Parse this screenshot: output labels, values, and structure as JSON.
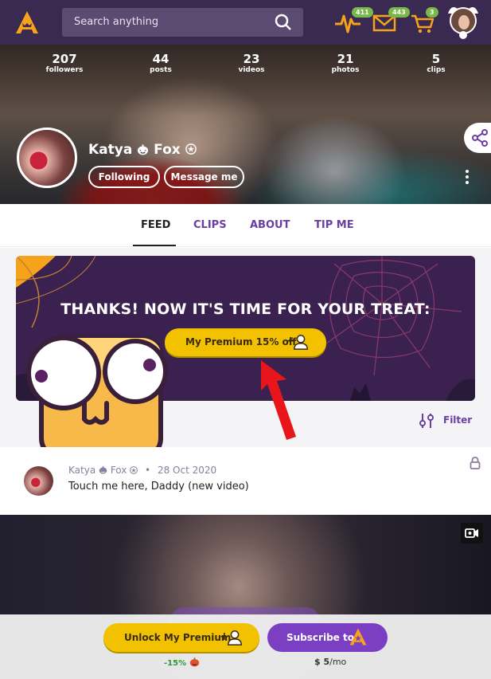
{
  "header": {
    "search_placeholder": "Search anything",
    "badges": {
      "activity": "411",
      "messages": "443",
      "cart": "3"
    }
  },
  "profile": {
    "stats": [
      {
        "value": "207",
        "label": "followers"
      },
      {
        "value": "44",
        "label": "posts"
      },
      {
        "value": "23",
        "label": "videos"
      },
      {
        "value": "21",
        "label": "photos"
      },
      {
        "value": "5",
        "label": "clips"
      }
    ],
    "name_first": "Katya",
    "name_last": "Fox",
    "following_label": "Following",
    "message_label": "Message me"
  },
  "tabs": [
    {
      "label": "FEED",
      "active": true
    },
    {
      "label": "CLIPS",
      "active": false
    },
    {
      "label": "ABOUT",
      "active": false
    },
    {
      "label": "TIP ME",
      "active": false
    }
  ],
  "promo": {
    "title": "THANKS! NOW IT'S TIME FOR YOUR TREAT:",
    "button_label": "My Premium 15% off",
    "button_plus": "+"
  },
  "filter_label": "Filter",
  "post": {
    "author": "Katya",
    "author_last": "Fox",
    "separator": "•",
    "date": "28 Oct 2020",
    "text": "Touch me here, Daddy (new video)"
  },
  "bottom": {
    "unlock_label": "Unlock My Premium",
    "unlock_plus": "+",
    "subscribe_label": "Subscribe to",
    "discount": "-15%",
    "price_amount": "$ 5",
    "price_period": "/mo"
  },
  "colors": {
    "topbar": "#3a2a52",
    "accent_purple": "#6a3fa3",
    "button_yellow": "#f2c200",
    "badge_green": "#79b84a",
    "icon_orange": "#f7a21b"
  }
}
